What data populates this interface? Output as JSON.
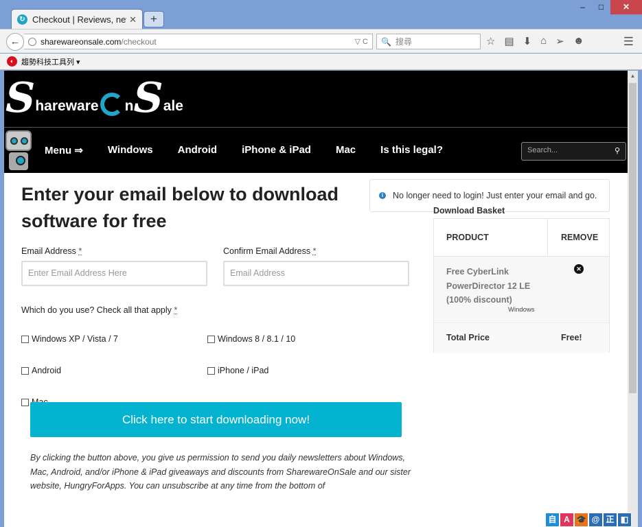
{
  "browser": {
    "tab_title": "Checkout | Reviews, news...",
    "tab_close": "✕",
    "newtab_label": "+",
    "url_host": "sharewareonsale.com",
    "url_path": "/checkout",
    "url_controls": "▽ C",
    "search_placeholder": "搜尋",
    "bookmark_label": "趨勢科技工具列 ▾",
    "window_buttons": {
      "minimize": "–",
      "maximize": "□",
      "close": "✕"
    }
  },
  "site": {
    "logo_letters": {
      "s1": "S",
      "hareware": "hareware",
      "o": "O",
      "n": "n",
      "s2": "S",
      "ale": "ale"
    },
    "nav": [
      "Menu ⇒",
      "Windows",
      "Android",
      "iPhone & iPad",
      "Mac",
      "Is this legal?"
    ],
    "search_placeholder": "Search..."
  },
  "checkout": {
    "heading": "Enter your email below to download software for free",
    "notice": "No longer need to login! Just enter your email and go.",
    "email_label": "Email Address",
    "email_placeholder": "Enter Email Address Here",
    "confirm_label": "Confirm Email Address",
    "confirm_placeholder": "Email Address",
    "required_mark": "*",
    "platform_question": "Which do you use? Check all that apply",
    "platforms": [
      "Windows XP / Vista / 7",
      "Windows 8 / 8.1 / 10",
      "Android",
      "iPhone / iPad",
      "Mac"
    ],
    "cta": "Click here to start downloading now!",
    "disclaimer": "By clicking the button above, you give us permission to send you daily newsletters about Windows, Mac, Android, and/or iPhone & iPad giveaways and discounts from SharewareOnSale and our sister website, HungryForApps. You can unsubscribe at any time from the bottom of"
  },
  "basket": {
    "title": "Download Basket",
    "col_product": "PRODUCT",
    "col_remove": "REMOVE",
    "item_name": "Free CyberLink PowerDirector 12 LE (100% discount)",
    "item_platform": "Windows",
    "total_label": "Total Price",
    "total_value": "Free!"
  },
  "taskbar_glyphs": [
    "自",
    "A",
    "🎓",
    "@",
    "正",
    "◧"
  ],
  "colors": {
    "accent": "#03b3cf",
    "header_bg": "#000000",
    "window_frame": "#7c9fd6"
  }
}
